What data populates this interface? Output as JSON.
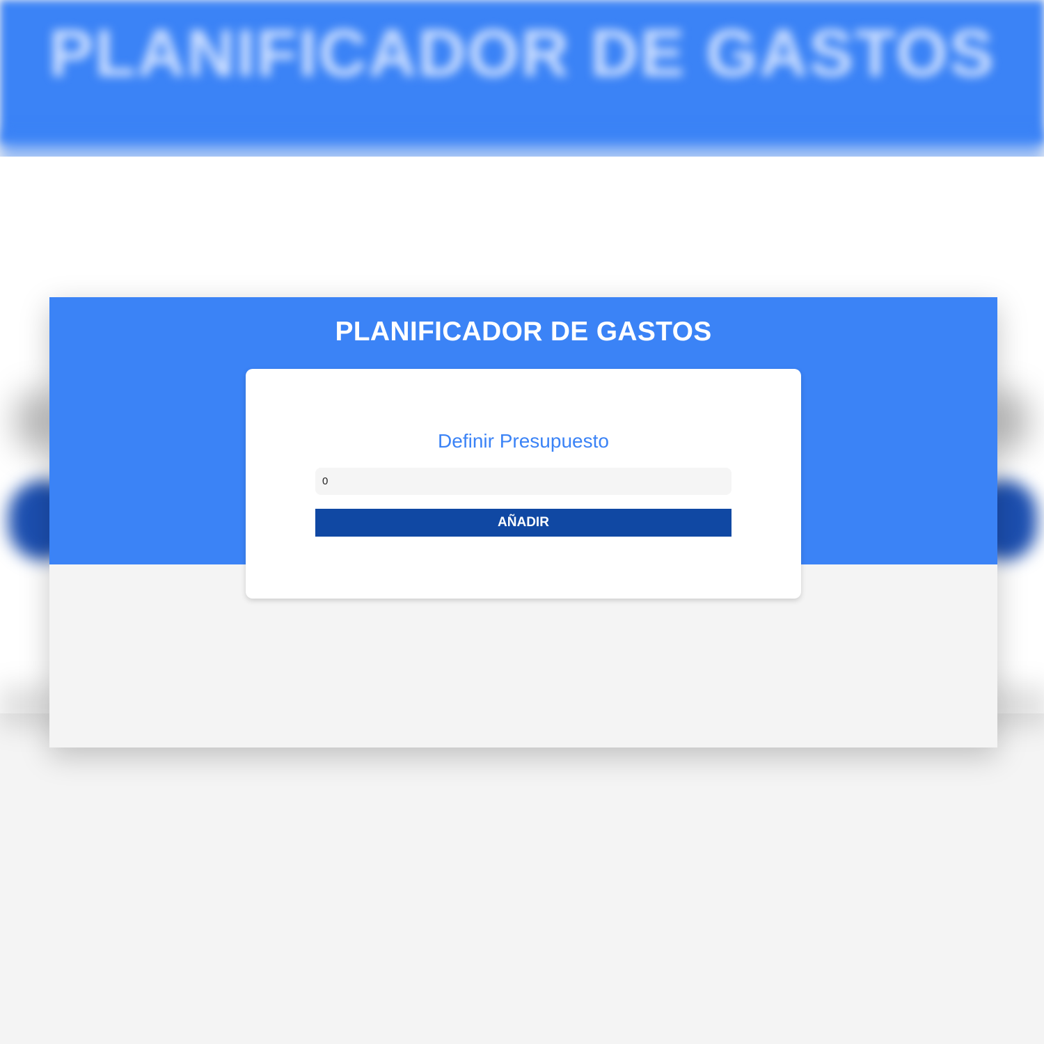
{
  "app": {
    "title": "PLANIFICADOR DE GASTOS"
  },
  "budget": {
    "label": "Definir Presupuesto",
    "value": "0",
    "submit_label": "AÑADIR"
  },
  "colors": {
    "header": "#3b83f6",
    "label": "#3b83f6",
    "button": "#1048a3",
    "card": "#ffffff",
    "page_background": "#f4f4f4"
  }
}
